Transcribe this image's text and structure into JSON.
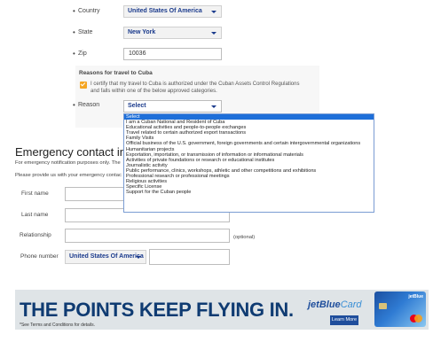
{
  "address": {
    "country": {
      "label": "Country",
      "value": "United States Of America"
    },
    "state": {
      "label": "State",
      "value": "New York"
    },
    "zip": {
      "label": "Zip",
      "value": "10036"
    }
  },
  "cuba": {
    "title": "Reasons for travel to Cuba",
    "certify_line1": "I certify that my travel to Cuba is authorized under the Cuban Assets Control Regulations",
    "certify_line2": "and falls within one of the below approved categories.",
    "reason_label": "Reason",
    "reason_value": "Select",
    "options": [
      "Select",
      "I am a Cuban National and Resident of Cuba",
      "Educational activities and people-to-people exchanges",
      "Travel related to certain authorized export transactions",
      "Family Visits",
      "Official business of the U.S. government, foreign governments and certain intergovernmental organizations",
      "Humanitarian projects",
      "Exportation, importation, or transmission of information or informational materials",
      "Activities of private foundations or research or educational institutes",
      "Journalistic activity",
      "Public performance, clinics, workshops, athletic and other competitions and exhibitions",
      "Professional research or professional meetings",
      "Religious activities",
      "Specific License",
      "Support for the Cuban people"
    ],
    "selected_index": 0
  },
  "emergency": {
    "heading": "Emergency contact inform",
    "note1": "For emergency notification purposes only. The",
    "note2": "Please provide us with your emergency contac",
    "first_name_label": "First name",
    "last_name_label": "Last name",
    "relationship_label": "Relationship",
    "relationship_hint": "(optional)",
    "phone_label": "Phone number",
    "phone_country": "United States Of America"
  },
  "ad": {
    "headline": "THE POINTS KEEP FLYING IN.",
    "footnote": "*See Terms and Conditions for details.",
    "brand_main": "jetBlue",
    "brand_sub": "Card",
    "button": "Learn More",
    "card_brand": "jetBlue"
  },
  "colors": {
    "accent": "#f5a623",
    "link_blue": "#1a3a8c",
    "highlight": "#1e6fd9",
    "ad_navy": "#0f3b72"
  }
}
